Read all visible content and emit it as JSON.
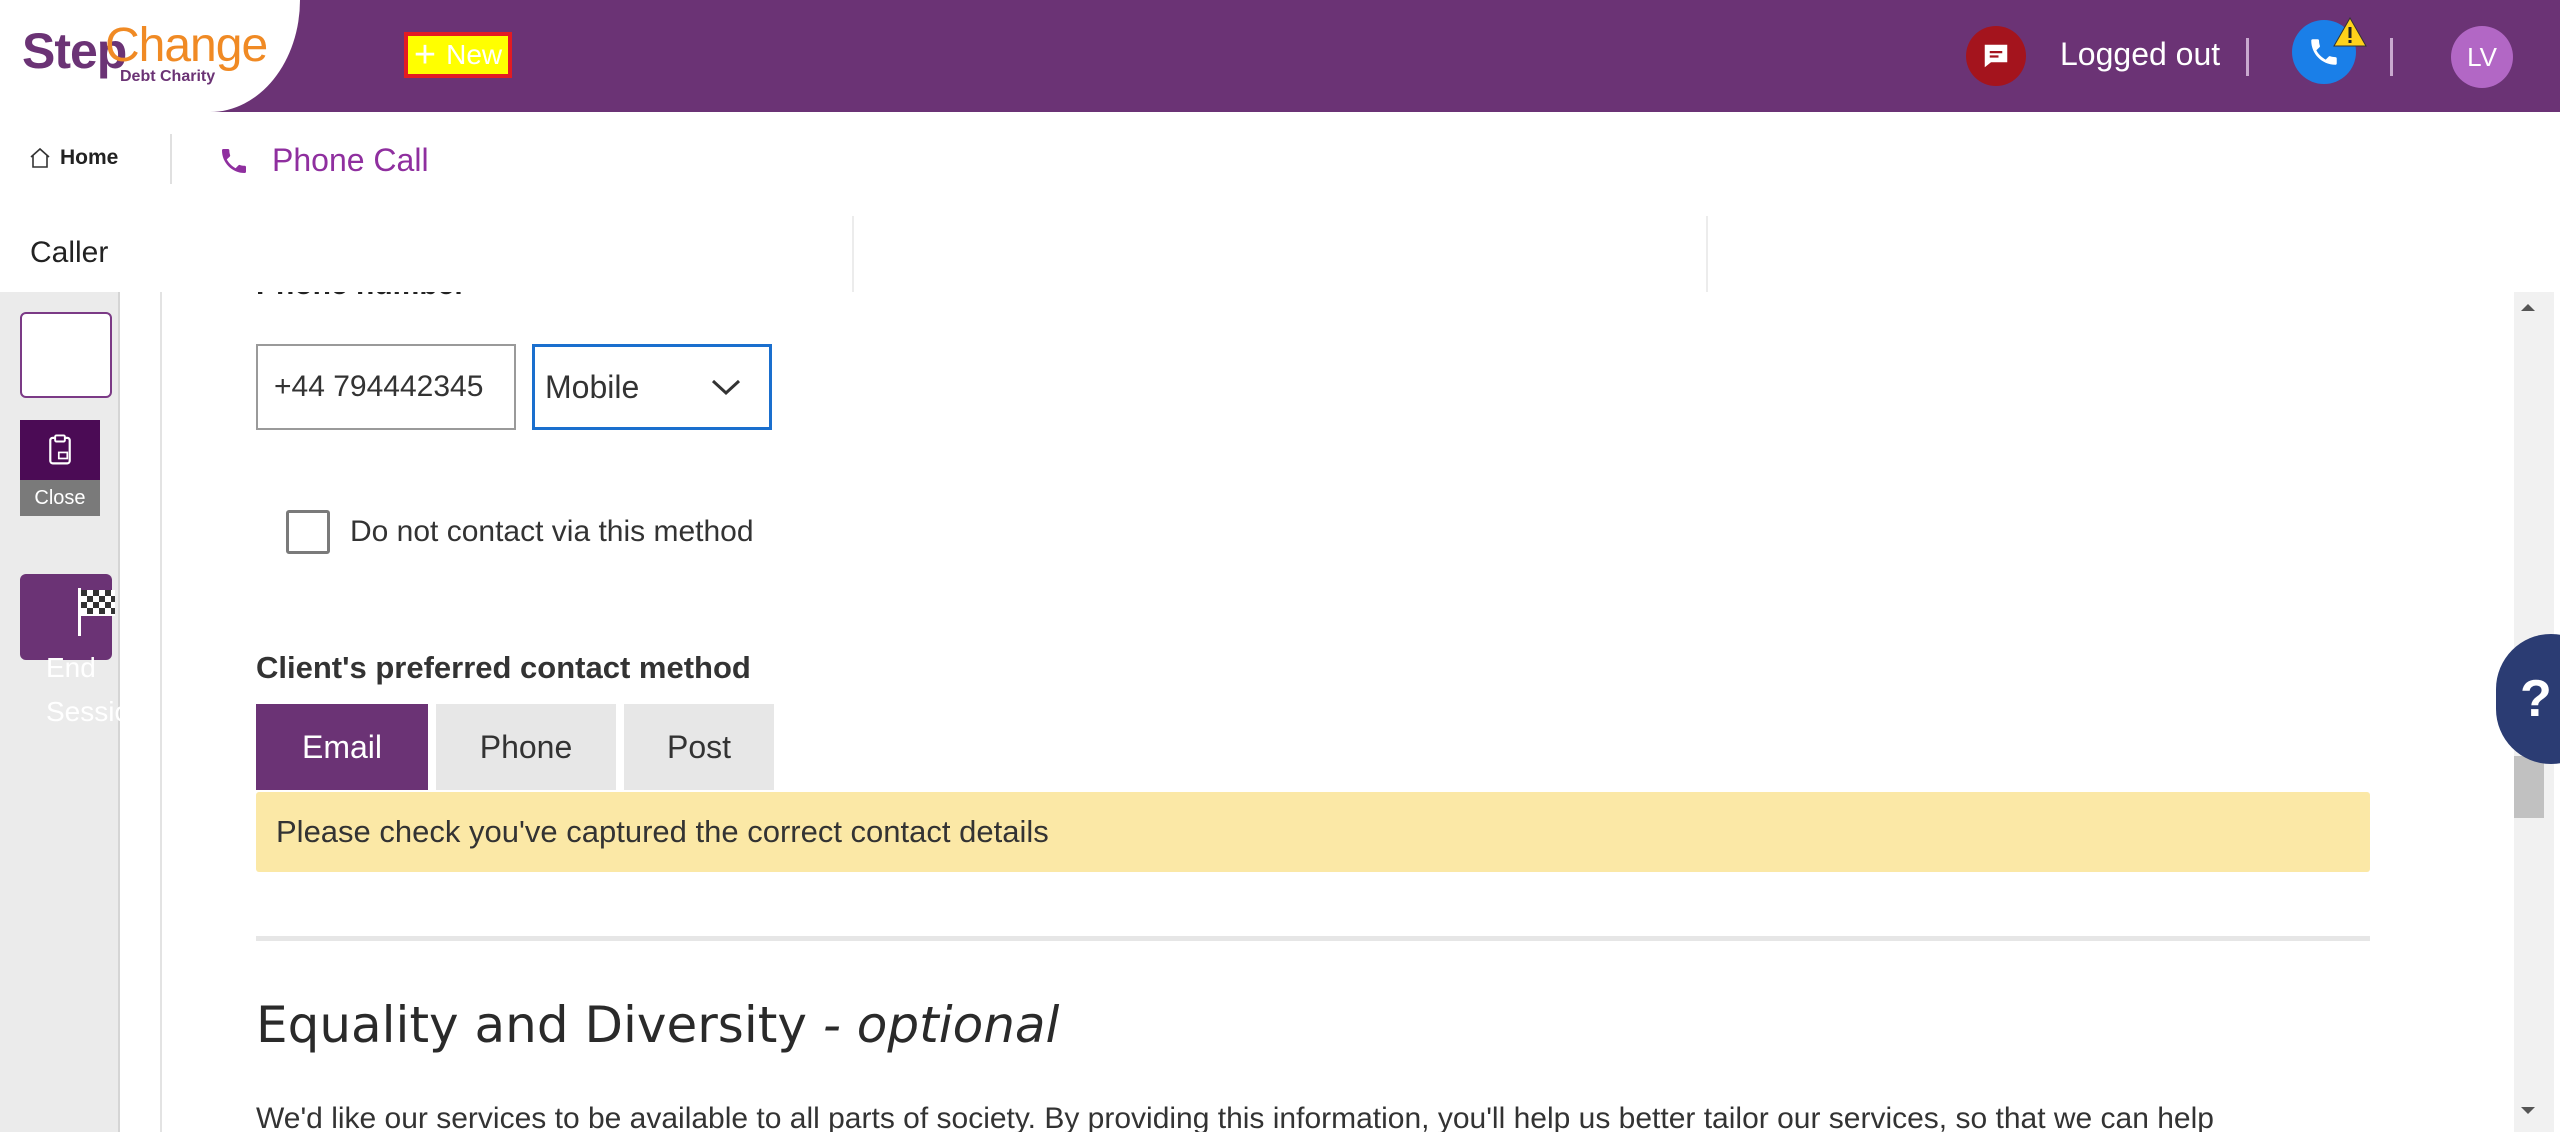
{
  "header": {
    "logo": {
      "step": "Step",
      "change": "Change",
      "sub": "Debt Charity"
    },
    "new_button": "New",
    "status_text": "Logged out",
    "avatar_initials": "LV",
    "colors": {
      "bar": "#6b3375",
      "chat": "#a4141d",
      "phone": "#1a7fe8",
      "avatar": "#b267c5"
    }
  },
  "nav": {
    "home": "Home",
    "tab": "Phone Call"
  },
  "caller_bar": {
    "title": "Caller"
  },
  "left_rail": {
    "close_label": "Close",
    "end_session_label_line1": "End",
    "end_session_label_line2": "Session"
  },
  "form": {
    "phone_label": "Phone number",
    "phone_value": "+44 794442345",
    "phone_type_selected": "Mobile",
    "do_not_contact_label": "Do not contact via this method",
    "do_not_contact_checked": false,
    "preferred_contact_label": "Client's preferred contact method",
    "preferred_options": [
      "Email",
      "Phone",
      "Post"
    ],
    "preferred_selected": "Email",
    "notice": "Please check you've captured the correct contact details"
  },
  "equality": {
    "title": "Equality and Diversity",
    "title_suffix": "- optional",
    "body": "We'd like our services to be available to all parts of society. By providing this information, you'll help us better tailor our services, so that we can help"
  },
  "help": {
    "label": "?"
  }
}
